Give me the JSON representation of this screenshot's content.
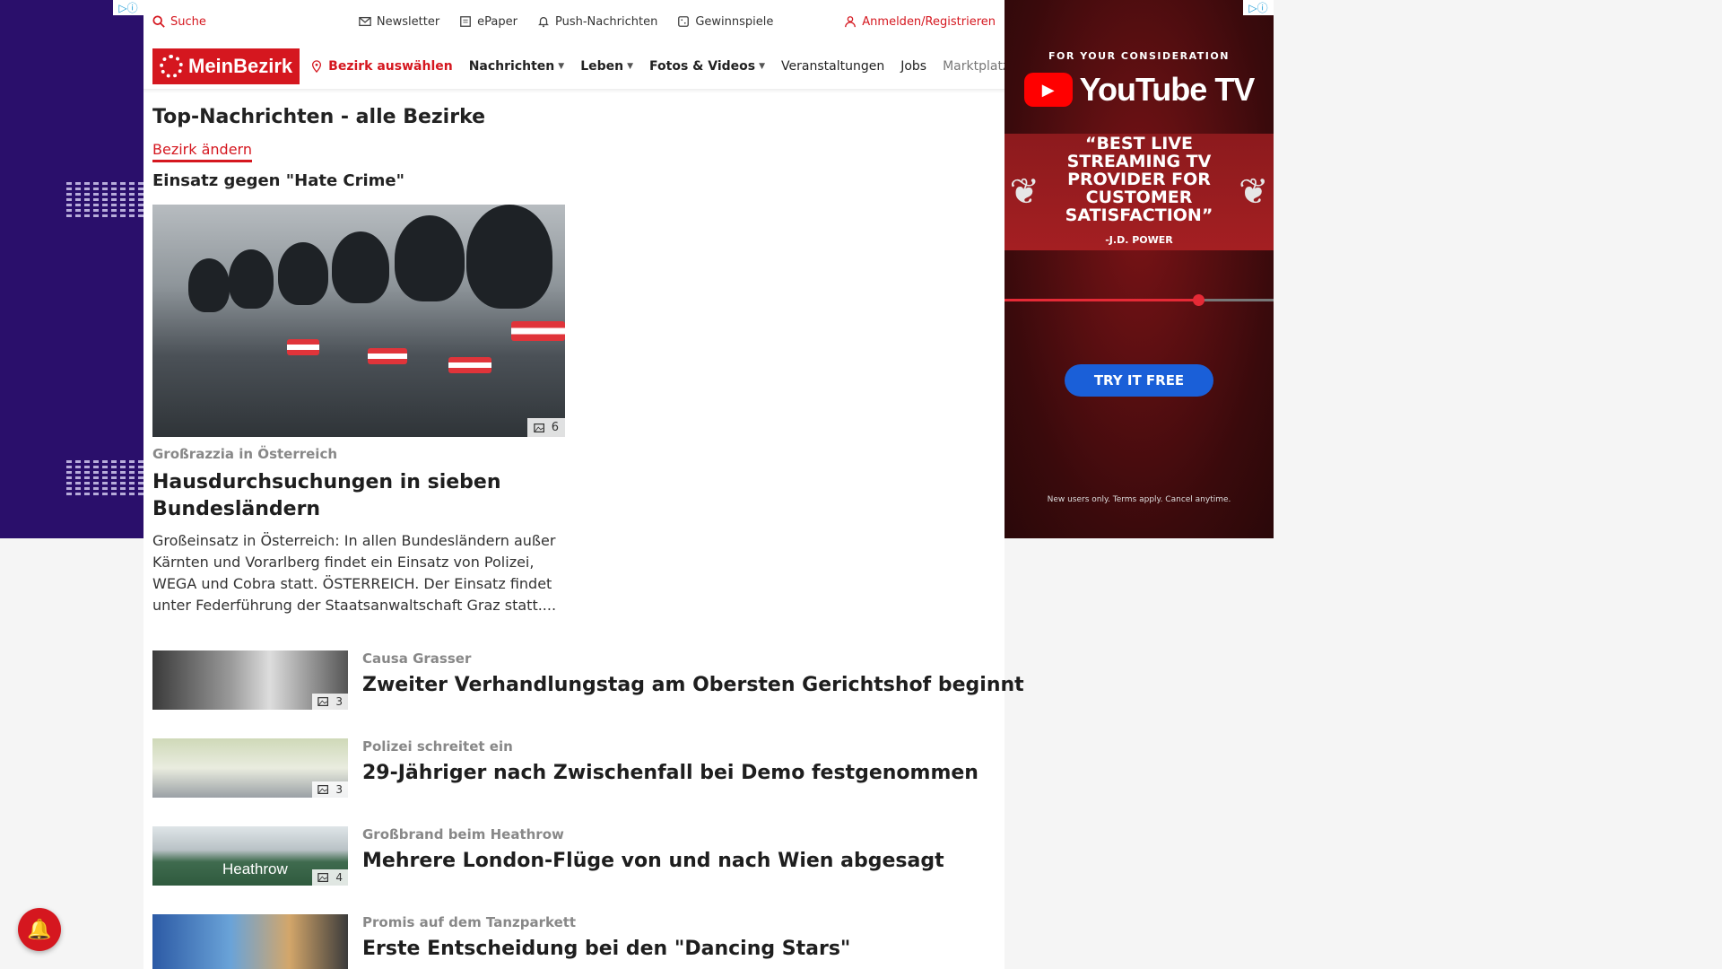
{
  "topbar": {
    "search_label": "Suche",
    "links": [
      {
        "icon": "mail-icon",
        "label": "Newsletter"
      },
      {
        "icon": "newspaper-icon",
        "label": "ePaper"
      },
      {
        "icon": "bell-icon",
        "label": "Push-Nachrichten"
      },
      {
        "icon": "gift-icon",
        "label": "Gewinnspiele"
      }
    ],
    "login_label": "Anmelden/Registrieren"
  },
  "nav": {
    "logo": "MeinBezirk",
    "bezirk_label": "Bezirk auswählen",
    "items": [
      {
        "label": "Nachrichten",
        "dropdown": true
      },
      {
        "label": "Leben",
        "dropdown": true
      },
      {
        "label": "Fotos & Videos",
        "dropdown": true
      },
      {
        "label": "Veranstaltungen",
        "dropdown": false
      },
      {
        "label": "Jobs",
        "dropdown": false
      },
      {
        "label": "Marktplatz",
        "dropdown": false
      }
    ]
  },
  "page": {
    "title": "Top-Nachrichten - alle Bezirke",
    "change_link": "Bezirk ändern",
    "topic": "Einsatz gegen \"Hate Crime\""
  },
  "hero": {
    "image_count": "6",
    "kicker": "Großrazzia in Österreich",
    "title": "Hausdurchsuchungen in sieben Bundesländern",
    "teaser": "Großeinsatz in Österreich: In allen Bundesländern außer Kärnten und Vorarlberg findet ein Einsatz von Polizei, WEGA und Cobra statt. ÖSTERREICH. Der Einsatz findet unter Federführung der Staatsanwaltschaft Graz statt...."
  },
  "articles": [
    {
      "image_count": "3",
      "kicker": "Causa Grasser",
      "title": "Zweiter Verhandlungstag am Obersten Gerichtshof beginnt"
    },
    {
      "image_count": "3",
      "kicker": "Polizei schreitet ein",
      "title": "29-Jähriger nach Zwischenfall bei Demo festgenommen"
    },
    {
      "image_count": "4",
      "kicker": "Großbrand beim Heathrow",
      "title": "Mehrere London-Flüge von und nach Wien abgesagt",
      "sign_text": "Heathrow"
    },
    {
      "image_count": "",
      "kicker": "Promis auf dem Tanzparkett",
      "title": "Erste Entscheidung bei den \"Dancing Stars\""
    }
  ],
  "ad_right": {
    "consider": "FOR YOUR CONSIDERATION",
    "brand": "YouTube TV",
    "quote": "“BEST LIVE STREAMING TV PROVIDER FOR CUSTOMER SATISFACTION”",
    "quote_by": "-J.D. POWER",
    "progress": 0.72,
    "cta": "TRY IT FREE",
    "fine_print": "New users only. Terms apply. Cancel anytime."
  },
  "colors": {
    "brand_red": "#d5171f",
    "cta_blue": "#1a5fd8"
  }
}
